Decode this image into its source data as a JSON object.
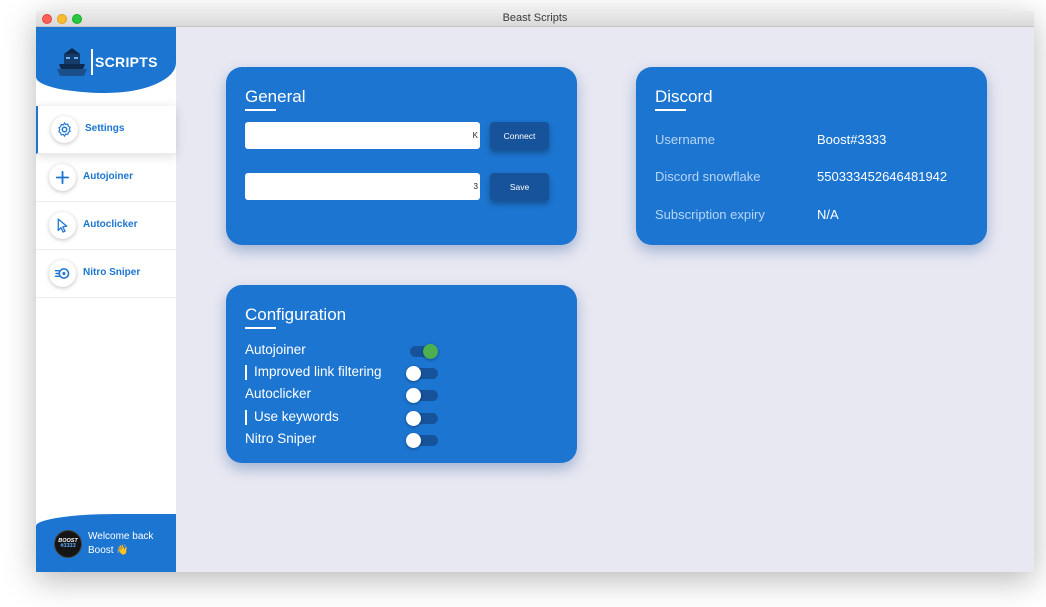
{
  "window": {
    "title": "Beast Scripts"
  },
  "sidebar": {
    "brand": "SCRIPTS",
    "items": [
      {
        "label": "Settings",
        "icon": "gear-icon",
        "active": true
      },
      {
        "label": "Autojoiner",
        "icon": "plus-icon",
        "active": false
      },
      {
        "label": "Autoclicker",
        "icon": "cursor-icon",
        "active": false
      },
      {
        "label": "Nitro Sniper",
        "icon": "nitro-icon",
        "active": false
      }
    ],
    "footer": {
      "avatar_text_1": "BOOST",
      "avatar_text_2": "#3333",
      "welcome": "Welcome back",
      "name": "Boost 👋"
    }
  },
  "general": {
    "title": "General",
    "token_value": "K",
    "delay_value": "3",
    "connect_label": "Connect",
    "save_label": "Save"
  },
  "discord": {
    "title": "Discord",
    "rows": [
      {
        "label": "Username",
        "value": "Boost#3333"
      },
      {
        "label": "Discord snowflake",
        "value": "550333452646481942"
      },
      {
        "label": "Subscription expiry",
        "value": "N/A"
      }
    ]
  },
  "configuration": {
    "title": "Configuration",
    "options": [
      {
        "label": "Autojoiner",
        "enabled": true,
        "sub": false
      },
      {
        "label": "Improved link filtering",
        "enabled": false,
        "sub": true
      },
      {
        "label": "Autoclicker",
        "enabled": false,
        "sub": false
      },
      {
        "label": "Use keywords",
        "enabled": false,
        "sub": true
      },
      {
        "label": "Nitro Sniper",
        "enabled": false,
        "sub": false
      }
    ]
  },
  "colors": {
    "accent": "#1c75d0",
    "button": "#17539a",
    "background": "#e8e8f2",
    "toggle_on": "#4caf50"
  }
}
